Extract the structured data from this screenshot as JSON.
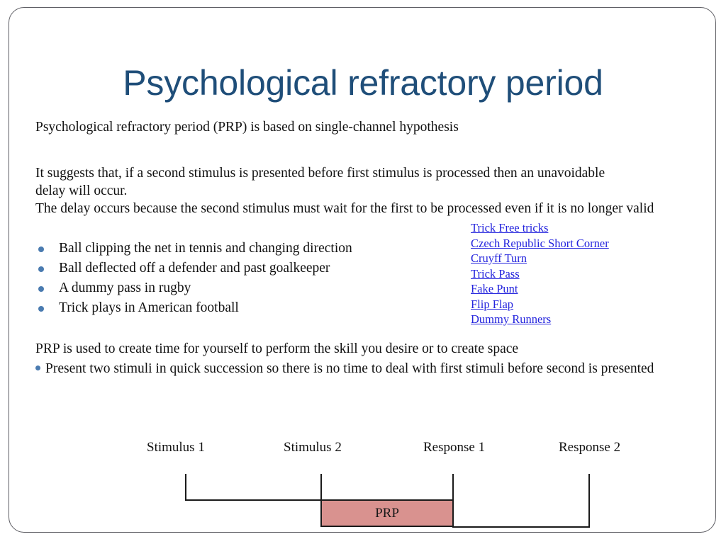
{
  "slide": {
    "title": "Psychological refractory period",
    "title_color": "#1f4e79",
    "frame_color": "#5d5d63",
    "background": "#ffffff"
  },
  "body": {
    "intro": "Psychological refractory period (PRP) is based on single-channel hypothesis",
    "suggests": "It suggests that, if a second stimulus is presented before first stimulus is processed then an unavoidable delay will occur.",
    "delay": "The delay occurs because the second stimulus must wait for the first to be processed even if it is no longer valid",
    "prp_use": "PRP is used to create time for yourself to perform the skill you desire or to create space",
    "present": "Present two stimuli in quick succession so there is no time to deal with first stimuli before second is presented",
    "bullet_color": "#4a7bb0"
  },
  "examples": {
    "items": [
      {
        "label": "Ball clipping the net in tennis and changing direction"
      },
      {
        "label": "Ball deflected off a defender and past goalkeeper"
      },
      {
        "label": "A dummy pass in rugby"
      },
      {
        "label": "Trick plays in American football"
      }
    ]
  },
  "links": {
    "color": "#2323dd",
    "items": [
      {
        "label": "Trick Free tricks"
      },
      {
        "label": "Czech Republic Short Corner"
      },
      {
        "label": "Cruyff Turn"
      },
      {
        "label": "Trick Pass"
      },
      {
        "label": "Fake Punt"
      },
      {
        "label": "Flip Flap"
      },
      {
        "label": "Dummy Runners"
      }
    ]
  },
  "diagram": {
    "labels": [
      {
        "text": "Stimulus 1"
      },
      {
        "text": "Stimulus 2"
      },
      {
        "text": "Response 1"
      },
      {
        "text": "Response 2"
      }
    ],
    "prp_label": "PRP",
    "prp_fill": "#d9928f",
    "line_color": "#1a1a1a"
  }
}
